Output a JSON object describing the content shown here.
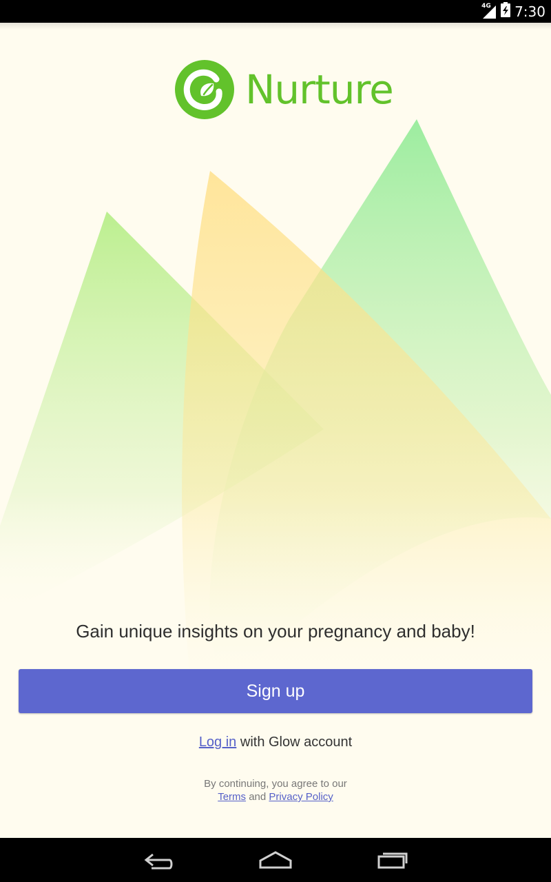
{
  "status_bar": {
    "network": "4G",
    "time": "7:30"
  },
  "app": {
    "name": "Nurture",
    "brand_color": "#62c22b"
  },
  "onboarding": {
    "tagline": "Gain unique insights on your pregnancy and baby!",
    "signup_label": "Sign up",
    "login_link": "Log in",
    "login_suffix": " with Glow account",
    "legal_prefix": "By continuing, you agree to our",
    "terms_link": "Terms",
    "legal_and": " and ",
    "privacy_link": "Privacy Policy",
    "button_color": "#5d67cf",
    "link_color": "#5560c8"
  },
  "nav_bar": {
    "back_icon": "back-icon",
    "home_icon": "home-icon",
    "recents_icon": "recent-apps-icon"
  }
}
